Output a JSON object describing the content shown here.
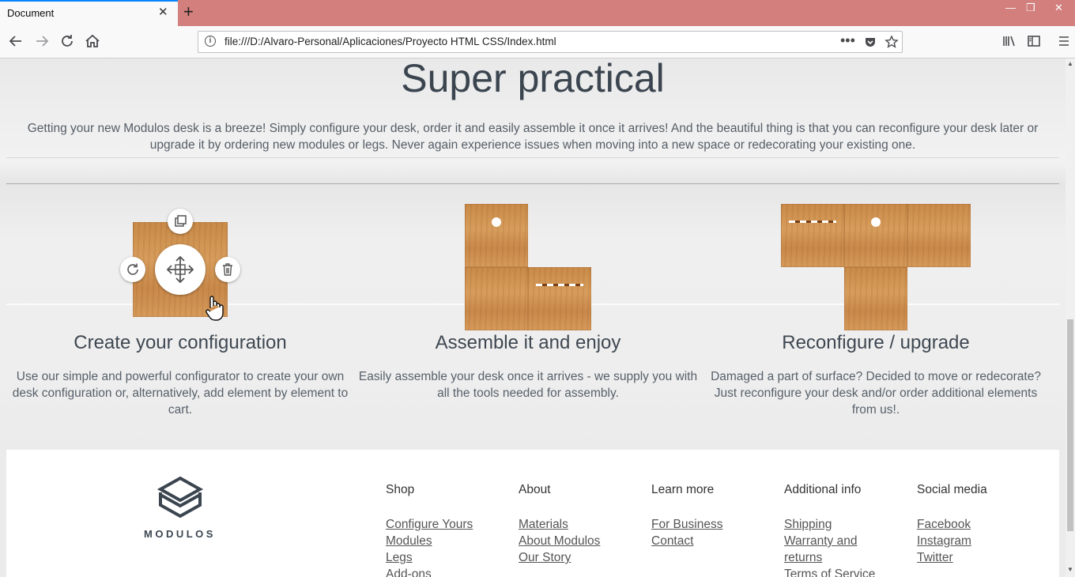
{
  "browser": {
    "tab_title": "Document",
    "tab_close": "✕",
    "new_tab": "+",
    "url": "file:///D:/Alvaro-Personal/Aplicaciones/Proyecto HTML CSS/Index.html",
    "window_min": "—",
    "window_restore": "❐",
    "window_close": "✕"
  },
  "section": {
    "title": "Super practical",
    "intro": "Getting your new Modulos desk is a breeze! Simply configure your desk, order it and easily assemble it once it arrives! And the beautiful thing is that you can reconfigure your desk later or upgrade it by ordering new modules or legs. Never again experience issues when moving into a new space or redecorating your existing one."
  },
  "cards": [
    {
      "title": "Create your configuration",
      "text": "Use our simple and powerful configurator to create your own desk configuration or, alternatively, add element by element to cart."
    },
    {
      "title": "Assemble it and enjoy",
      "text": "Easily assemble your desk once it arrives - we supply you with all the tools needed for assembly."
    },
    {
      "title": "Reconfigure / upgrade",
      "text": "Damaged a part of surface? Decided to move or redecorate? Just reconfigure your desk and/or order additional elements from us!."
    }
  ],
  "footer": {
    "brand": "MODULOS",
    "columns": [
      {
        "title": "Shop",
        "links": [
          "Configure Yours",
          "Modules",
          "Legs",
          "Add-ons"
        ]
      },
      {
        "title": "About",
        "links": [
          "Materials",
          "About Modulos",
          "Our Story"
        ]
      },
      {
        "title": "Learn more",
        "links": [
          "For Business",
          "Contact"
        ]
      },
      {
        "title": "Additional info",
        "links": [
          "Shipping",
          "Warranty and returns",
          "Terms of Service"
        ]
      },
      {
        "title": "Social media",
        "links": [
          "Facebook",
          "Instagram",
          "Twitter"
        ]
      }
    ]
  },
  "icons": {
    "back": "back-arrow-icon",
    "forward": "forward-arrow-icon",
    "reload": "reload-icon",
    "home": "home-icon",
    "duplicate": "duplicate-icon",
    "rotate": "rotate-icon",
    "move": "move-icon",
    "delete": "trash-icon"
  }
}
